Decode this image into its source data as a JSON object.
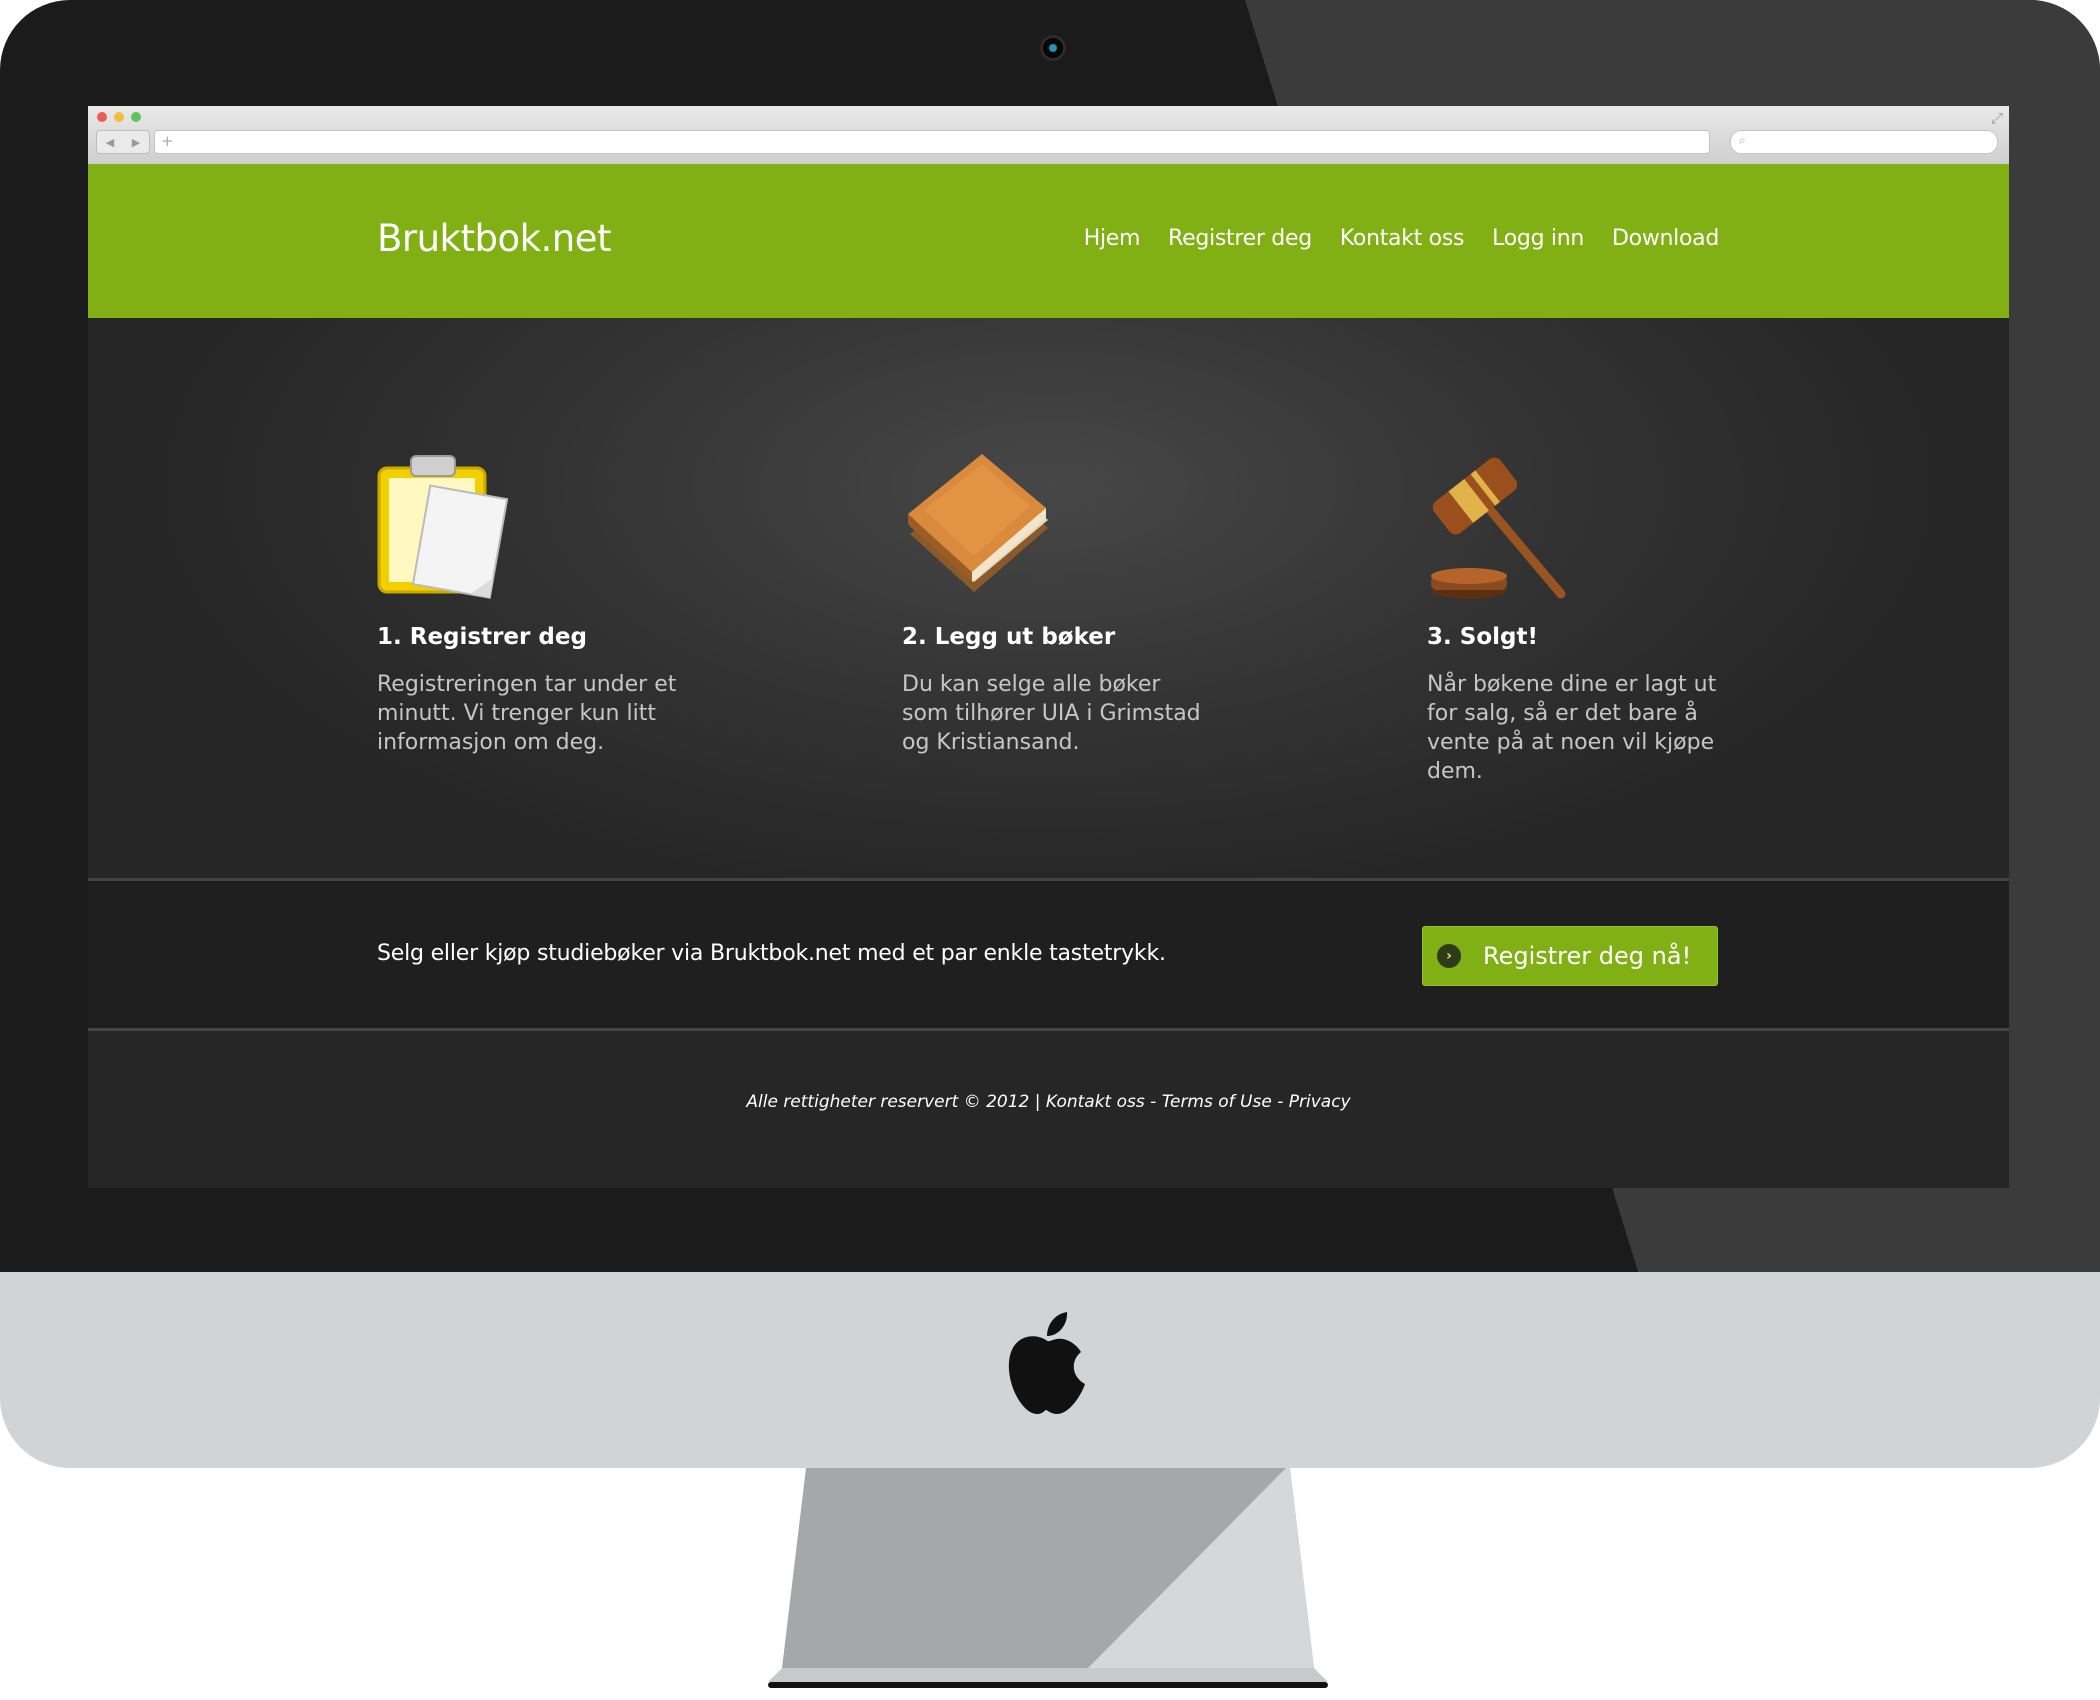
{
  "brand": {
    "name": "Bruktbok.net"
  },
  "nav": {
    "items": [
      "Hjem",
      "Registrer deg",
      "Kontakt oss",
      "Logg inn",
      "Download"
    ]
  },
  "steps": [
    {
      "title": "1. Registrer deg",
      "text": "Registreringen tar under et minutt. Vi trenger kun litt informasjon om deg.",
      "icon": "clipboard-icon"
    },
    {
      "title": "2. Legg ut bøker",
      "text": "Du kan selge alle bøker som tilhører UIA i Grimstad og Kristiansand.",
      "icon": "books-icon"
    },
    {
      "title": "3. Solgt!",
      "text": "Når bøkene dine er lagt ut for salg, så er det bare å vente på at noen vil kjøpe dem.",
      "icon": "gavel-icon"
    }
  ],
  "cta": {
    "text": "Selg eller kjøp studiebøker via Bruktbok.net med et par enkle tastetrykk.",
    "button_label": "Registrer deg nå!"
  },
  "footer": {
    "rights": "Alle rettigheter reservert © 2012 | ",
    "contact": "Kontakt oss",
    "sep1": " - ",
    "terms": "Terms of Use",
    "sep2": " - ",
    "privacy": "Privacy"
  },
  "colors": {
    "header_green": "#80b013",
    "page_dark": "#252525",
    "bezel": "#1b1b1b",
    "chin": "#d2d3d5"
  }
}
